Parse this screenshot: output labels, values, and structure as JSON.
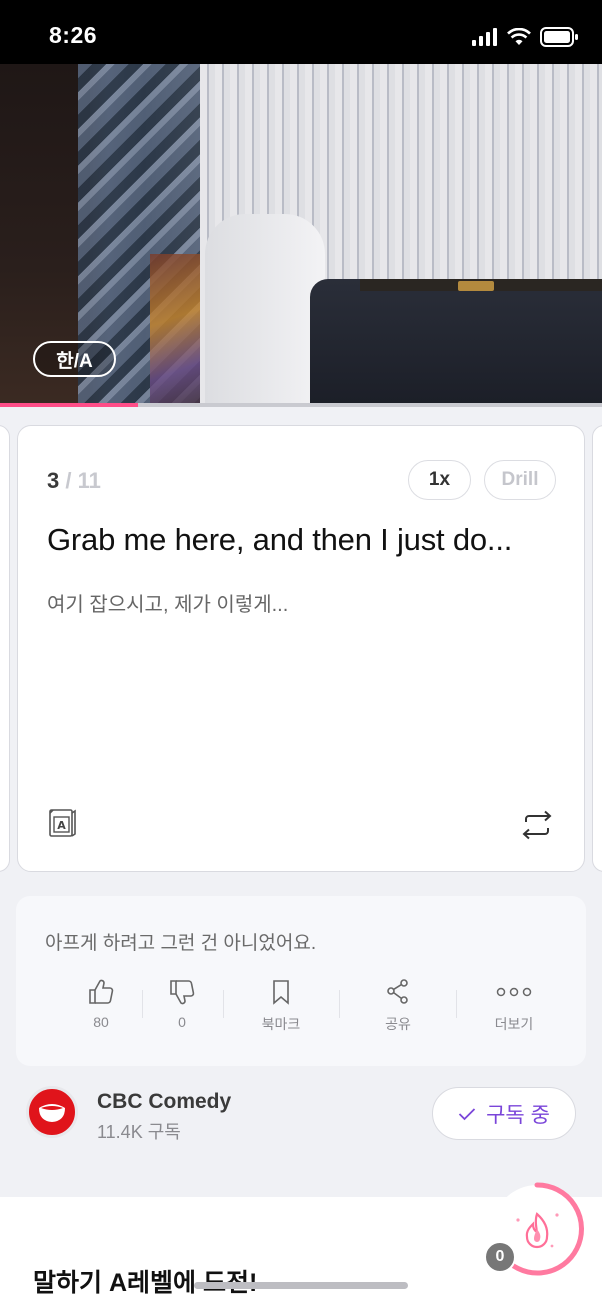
{
  "status_bar": {
    "time": "8:26"
  },
  "video": {
    "subtitle_toggle_label": "한/A",
    "progress": 0.23
  },
  "sentence_card": {
    "current": "3",
    "separator": " / ",
    "total": "11",
    "speed_label": "1x",
    "drill_label": "Drill",
    "english": "Grab me here, and then I just do...",
    "korean": "여기 잡으시고, 제가 이렇게..."
  },
  "description": {
    "text": "아프게 하려고 그런 건 아니었어요.",
    "actions": [
      {
        "label": "80",
        "icon": "thumbs-up-icon"
      },
      {
        "label": "0",
        "icon": "thumbs-down-icon"
      },
      {
        "label": "북마크",
        "icon": "bookmark-icon"
      },
      {
        "label": "공유",
        "icon": "share-icon"
      },
      {
        "label": "더보기",
        "icon": "more-icon"
      }
    ]
  },
  "channel": {
    "name": "CBC Comedy",
    "subscribers": "11.4K 구독",
    "subscribe_label": "구독 중"
  },
  "bottom": {
    "title": "말하기 A레벨에 도전!",
    "streak_count": "0"
  },
  "colors": {
    "accent_pink": "#ff4d88",
    "subscribe_purple": "#7a45d9",
    "logo_red": "#e0141b"
  }
}
